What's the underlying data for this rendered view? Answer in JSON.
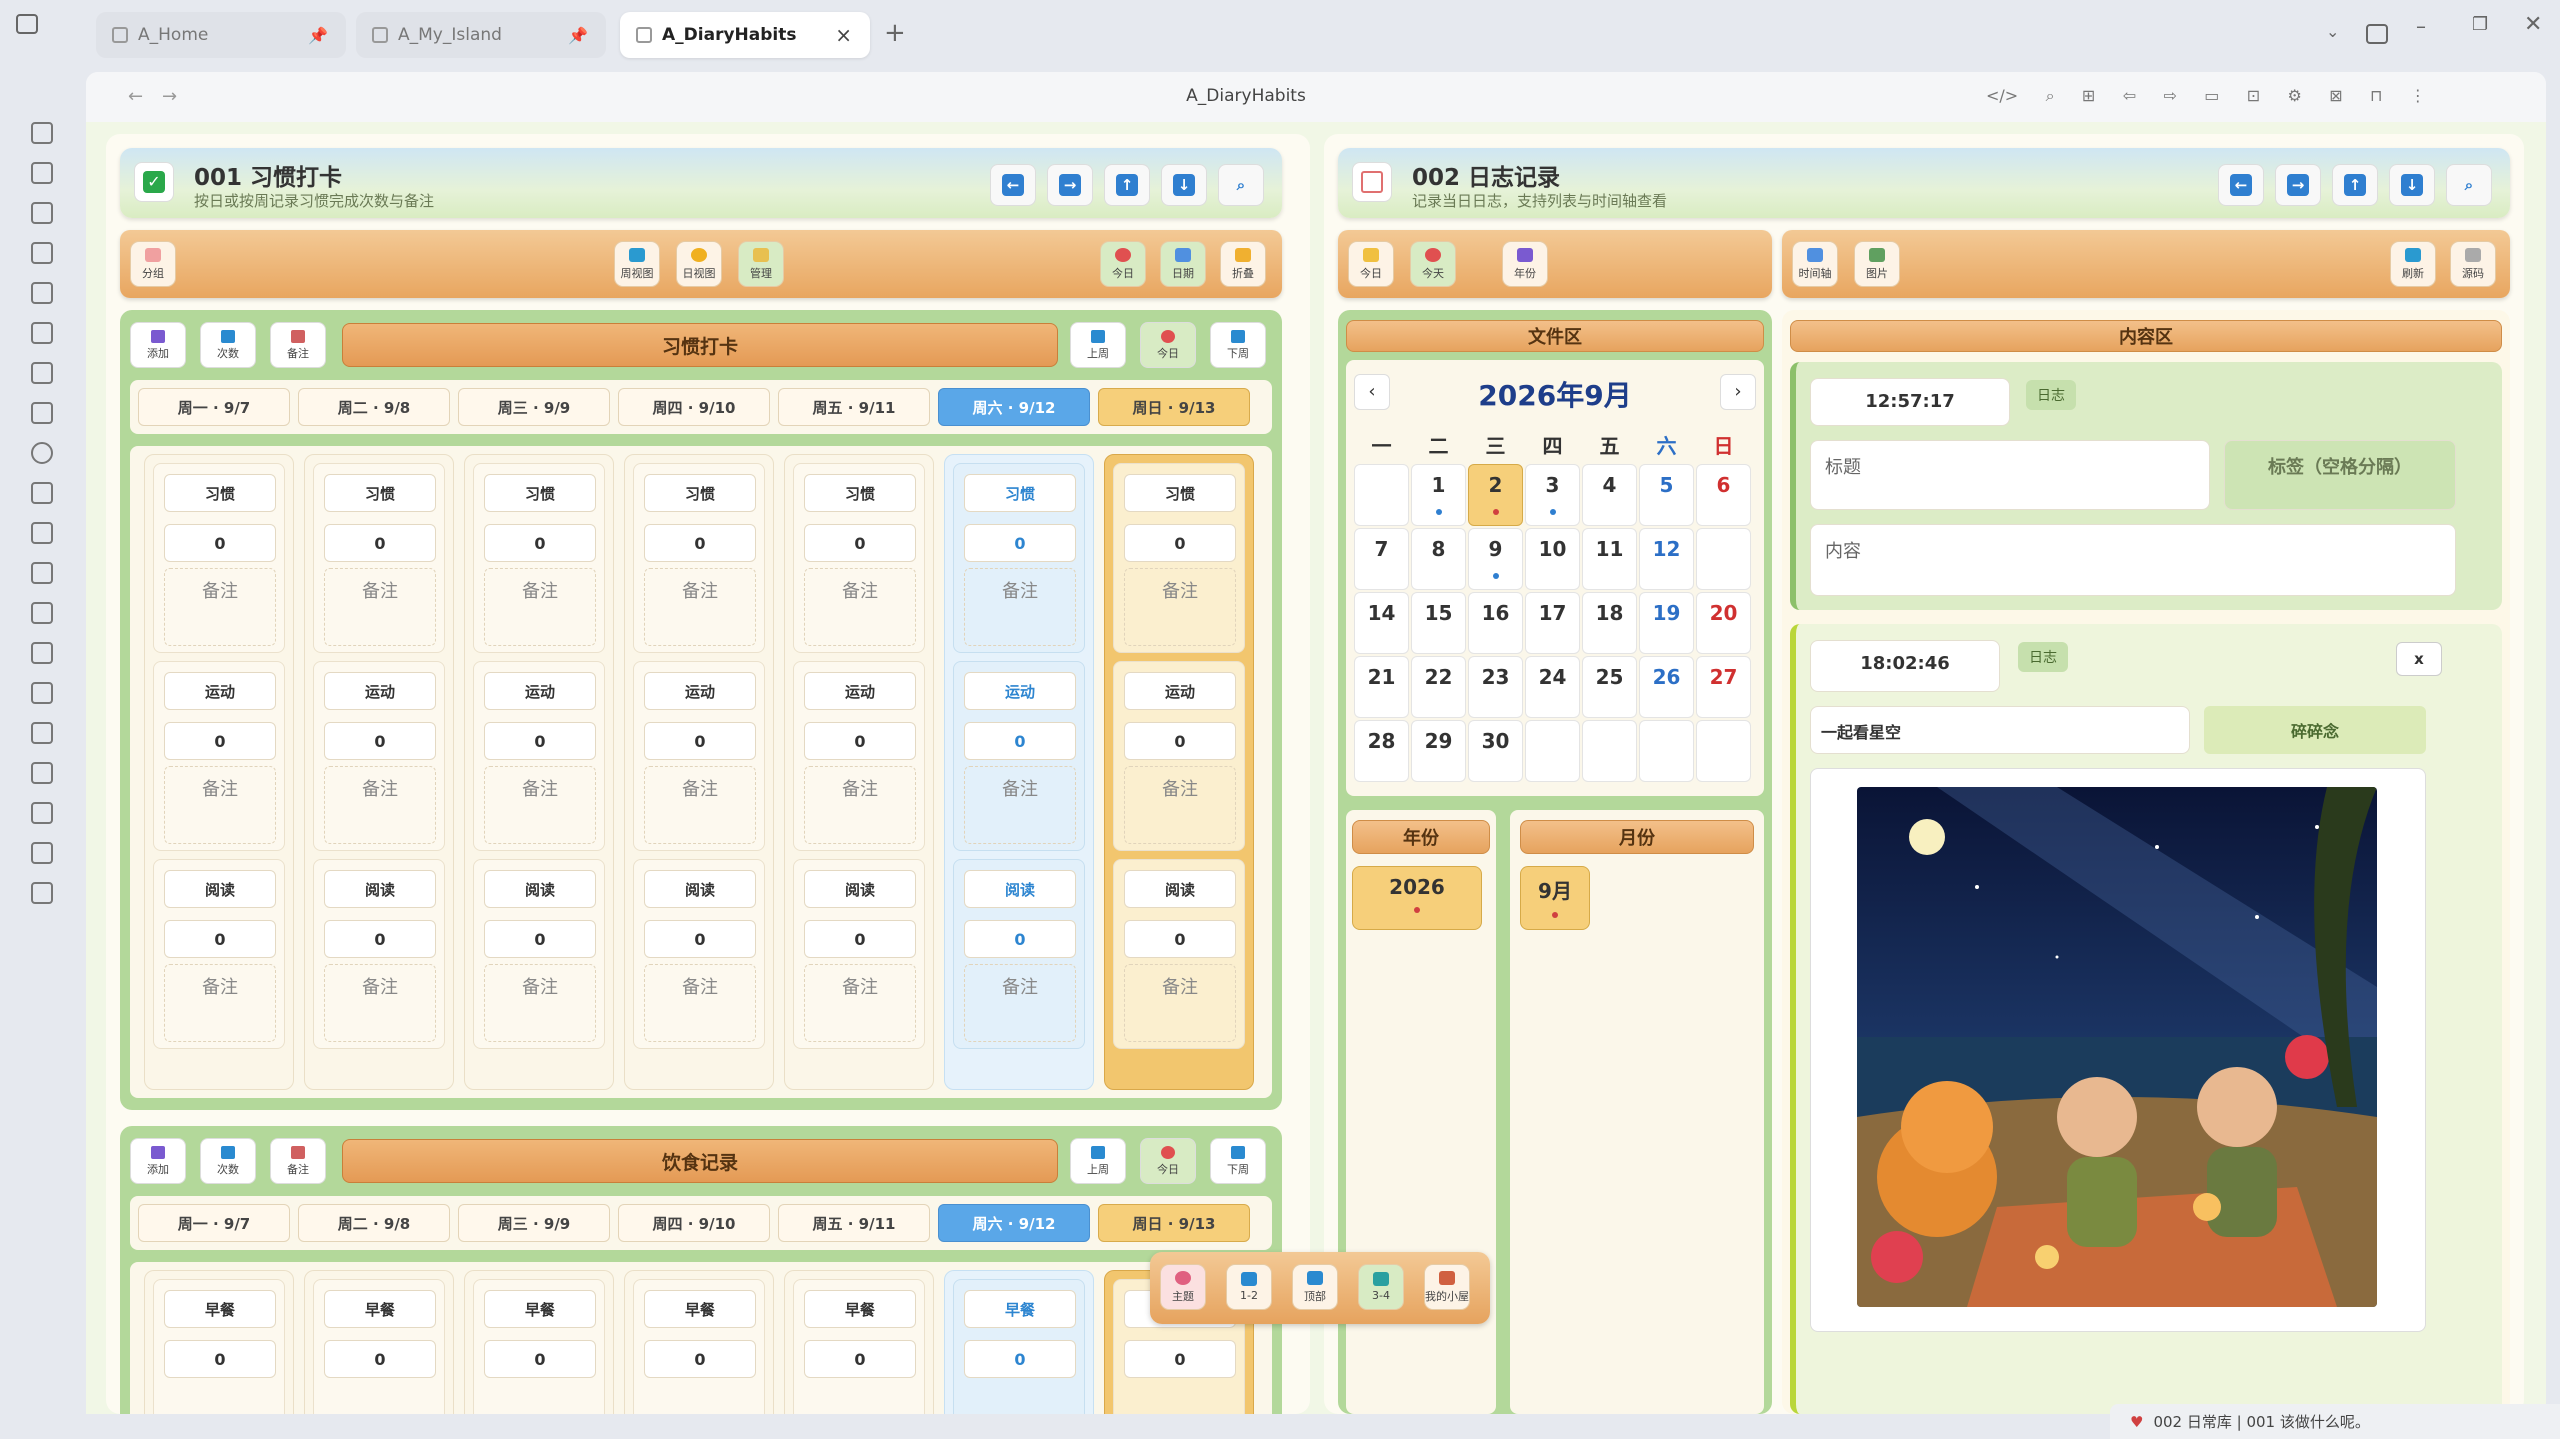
{
  "tabs": [
    {
      "label": "A_Home",
      "pinned": true
    },
    {
      "label": "A_My_Island",
      "pinned": true
    },
    {
      "label": "A_DiaryHabits",
      "active": true
    }
  ],
  "nav": {
    "title": "A_DiaryHabits"
  },
  "left": {
    "title": "001 习惯打卡",
    "subtitle": "按日或按周记录习惯完成次数与备注",
    "toolbar": {
      "group": "分组",
      "week_view": "周视图",
      "day_view": "日视图",
      "manage": "管理",
      "today": "今日",
      "date": "日期",
      "fold": "折叠"
    },
    "habit_section": {
      "title": "习惯打卡",
      "add": "添加",
      "count": "次数",
      "note": "备注",
      "prev": "上周",
      "today": "今日",
      "next": "下周",
      "days": [
        "周一 · 9/7",
        "周二 · 9/8",
        "周三 · 9/9",
        "周四 · 9/10",
        "周五 · 9/11",
        "周六 · 9/12",
        "周日 · 9/13"
      ],
      "habits": [
        {
          "name": "习惯",
          "value": "0",
          "note": "备注"
        },
        {
          "name": "运动",
          "value": "0",
          "note": "备注"
        },
        {
          "name": "阅读",
          "value": "0",
          "note": "备注"
        }
      ]
    },
    "diet_section": {
      "title": "饮食记录",
      "add": "添加",
      "count": "次数",
      "note": "备注",
      "prev": "上周",
      "today": "今日",
      "next": "下周",
      "days": [
        "周一 · 9/7",
        "周二 · 9/8",
        "周三 · 9/9",
        "周四 · 9/10",
        "周五 · 9/11",
        "周六 · 9/12",
        "周日 · 9/13"
      ],
      "meal": "早餐",
      "value": "0"
    }
  },
  "right": {
    "title": "002 日志记录",
    "subtitle": "记录当日日志，支持列表与时间轴查看",
    "toolbar_left": {
      "today": "今日",
      "now": "今天",
      "year": "年份"
    },
    "toolbar_right": {
      "timeline": "时间轴",
      "image": "图片",
      "refresh": "刷新",
      "source": "源码"
    },
    "file_area": "文件区",
    "content_area": "内容区",
    "calendar": {
      "title": "2026年9月",
      "weekdays": [
        "一",
        "二",
        "三",
        "四",
        "五",
        "六",
        "日"
      ],
      "weeks": [
        [
          "",
          "1",
          "2",
          "3",
          "4",
          "5",
          "6"
        ],
        [
          "7",
          "8",
          "9",
          "10",
          "11",
          "12",
          ""
        ],
        [
          "14",
          "15",
          "16",
          "17",
          "18",
          "19",
          "20"
        ],
        [
          "21",
          "22",
          "23",
          "24",
          "25",
          "26",
          "27"
        ],
        [
          "28",
          "29",
          "30",
          "",
          "",
          "",
          ""
        ]
      ]
    },
    "year_label": "年份",
    "month_label": "月份",
    "year_value": "2026",
    "month_value": "9月",
    "editor": {
      "time": "12:57:17",
      "tag": "日志",
      "title_placeholder": "标题",
      "tags_placeholder": "标签（空格分隔）",
      "content_placeholder": "内容"
    },
    "entry": {
      "time": "18:02:46",
      "tag": "日志",
      "close": "x",
      "title": "一起看星空",
      "category": "碎碎念"
    }
  },
  "float_bar": {
    "theme": "主题",
    "one_two": "1-2",
    "top": "顶部",
    "three_four": "3-4",
    "home": "我的小屋"
  },
  "status": {
    "text": "002 日常库 | 001 该做什么呢。"
  }
}
